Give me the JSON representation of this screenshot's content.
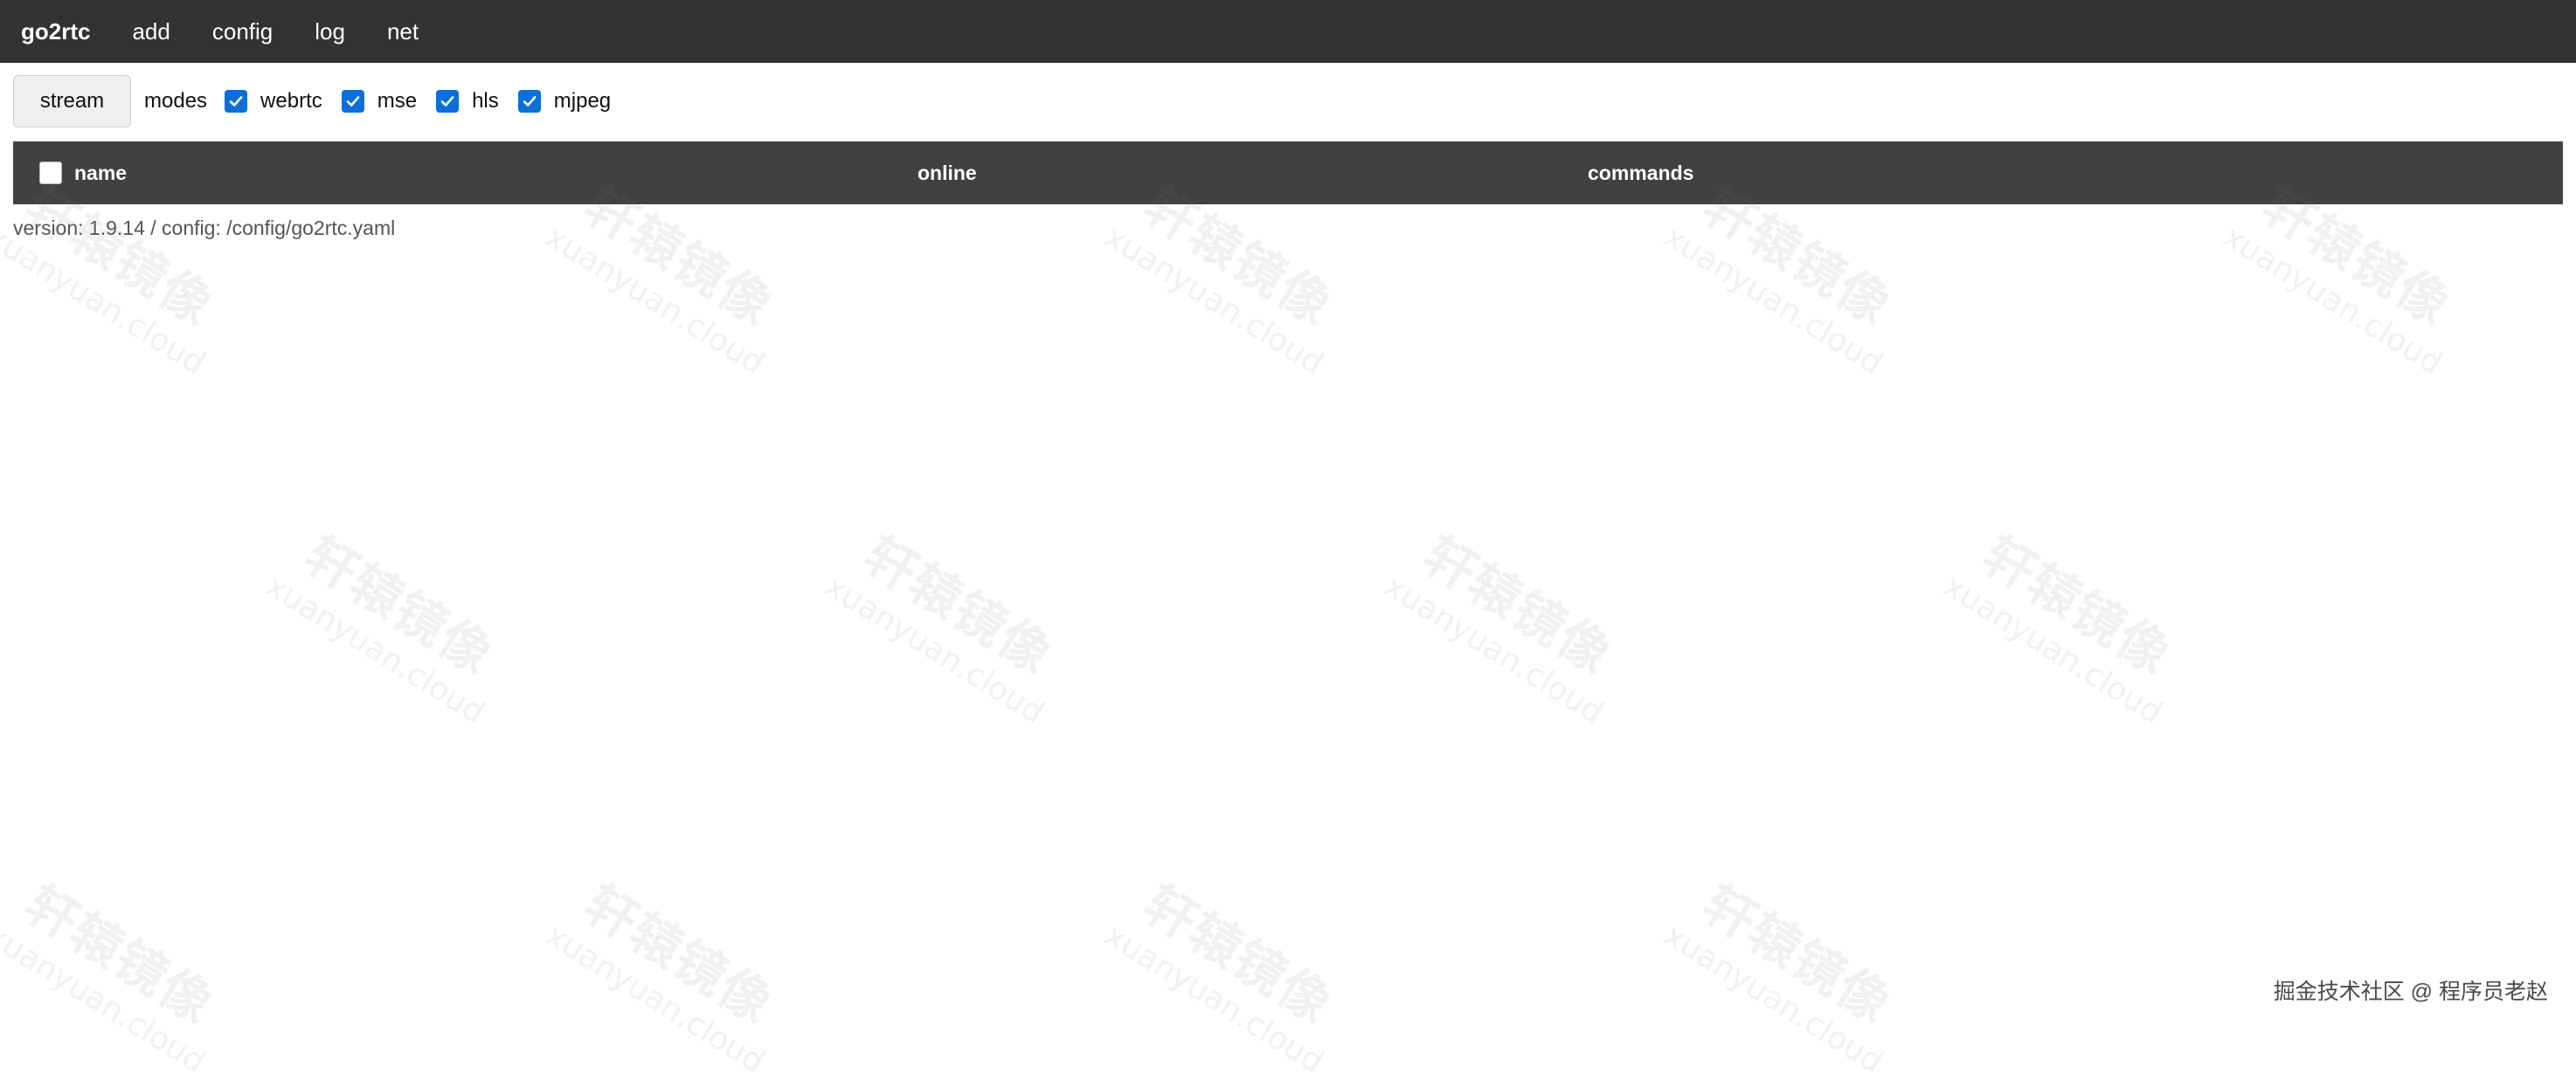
{
  "nav": {
    "brand": "go2rtc",
    "links": [
      "add",
      "config",
      "log",
      "net"
    ]
  },
  "toolbar": {
    "stream_button": "stream",
    "modes_label": "modes",
    "modes": [
      {
        "label": "webrtc",
        "checked": true
      },
      {
        "label": "mse",
        "checked": true
      },
      {
        "label": "hls",
        "checked": true
      },
      {
        "label": "mjpeg",
        "checked": true
      }
    ]
  },
  "table": {
    "columns": [
      "name",
      "online",
      "commands"
    ],
    "rows": []
  },
  "footer": {
    "version_text": "version: 1.9.14 / config: /config/go2rtc.yaml"
  },
  "watermark": {
    "cn": "轩辕镜像",
    "en": "xuanyuan.cloud"
  },
  "credit": {
    "text": "掘金技术社区 @ 程序员老赵"
  },
  "colors": {
    "nav_bg": "#333333",
    "table_header_bg": "#414141",
    "checkbox_checked": "#0b6fdb"
  }
}
